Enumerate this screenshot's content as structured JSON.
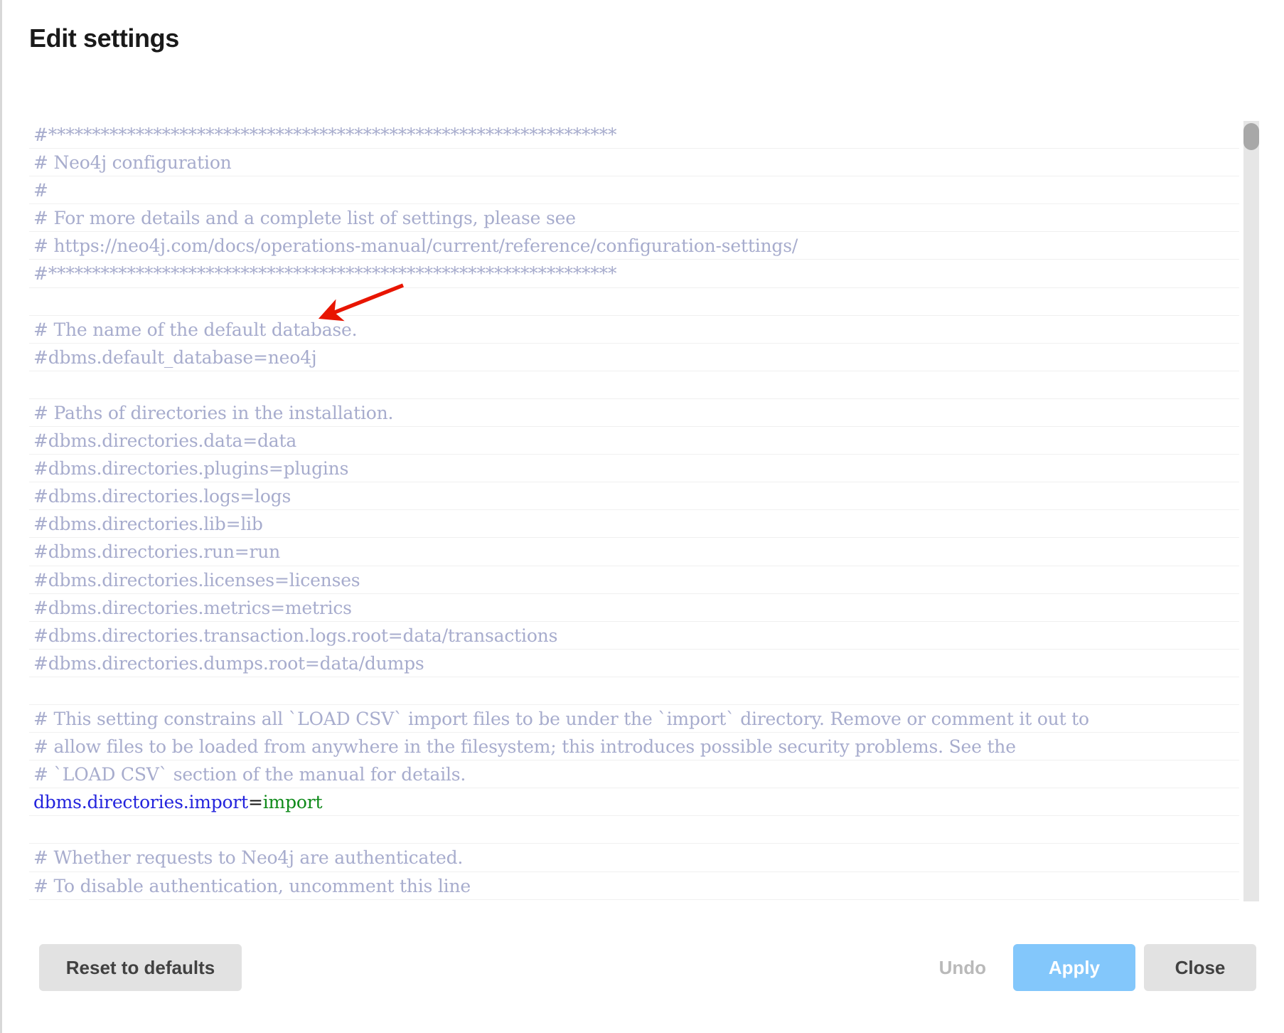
{
  "dialog": {
    "title": "Edit settings"
  },
  "editor": {
    "lines": [
      {
        "type": "comment",
        "text": "#*****************************************************************"
      },
      {
        "type": "comment",
        "text": "# Neo4j configuration"
      },
      {
        "type": "comment",
        "text": "#"
      },
      {
        "type": "comment",
        "text": "# For more details and a complete list of settings, please see"
      },
      {
        "type": "comment",
        "text": "# https://neo4j.com/docs/operations-manual/current/reference/configuration-settings/"
      },
      {
        "type": "comment",
        "text": "#*****************************************************************"
      },
      {
        "type": "blank",
        "text": ""
      },
      {
        "type": "comment",
        "text": "# The name of the default database."
      },
      {
        "type": "comment",
        "text": "#dbms.default_database=neo4j"
      },
      {
        "type": "blank",
        "text": ""
      },
      {
        "type": "comment",
        "text": "# Paths of directories in the installation."
      },
      {
        "type": "comment",
        "text": "#dbms.directories.data=data"
      },
      {
        "type": "comment",
        "text": "#dbms.directories.plugins=plugins"
      },
      {
        "type": "comment",
        "text": "#dbms.directories.logs=logs"
      },
      {
        "type": "comment",
        "text": "#dbms.directories.lib=lib"
      },
      {
        "type": "comment",
        "text": "#dbms.directories.run=run"
      },
      {
        "type": "comment",
        "text": "#dbms.directories.licenses=licenses"
      },
      {
        "type": "comment",
        "text": "#dbms.directories.metrics=metrics"
      },
      {
        "type": "comment",
        "text": "#dbms.directories.transaction.logs.root=data/transactions"
      },
      {
        "type": "comment",
        "text": "#dbms.directories.dumps.root=data/dumps"
      },
      {
        "type": "blank",
        "text": ""
      },
      {
        "type": "comment",
        "text": "# This setting constrains all `LOAD CSV` import files to be under the `import` directory. Remove or comment it out to"
      },
      {
        "type": "comment",
        "text": "# allow files to be loaded from anywhere in the filesystem; this introduces possible security problems. See the"
      },
      {
        "type": "comment",
        "text": "# `LOAD CSV` section of the manual for details."
      },
      {
        "type": "setting",
        "key": "dbms.directories.import",
        "eq": "=",
        "value": "import"
      },
      {
        "type": "blank",
        "text": ""
      },
      {
        "type": "comment",
        "text": "# Whether requests to Neo4j are authenticated."
      },
      {
        "type": "comment",
        "text": "# To disable authentication, uncomment this line"
      }
    ]
  },
  "annotation": {
    "arrow_color": "#e81500",
    "points_to": "#dbms.default_database=neo4j"
  },
  "scrollbar": {
    "thumb_position": "top"
  },
  "footer": {
    "reset_label": "Reset to defaults",
    "undo_label": "Undo",
    "apply_label": "Apply",
    "close_label": "Close"
  },
  "colors": {
    "comment": "#a7accd",
    "setting_key": "#2323dd",
    "setting_value": "#0f8a1a",
    "apply_bg": "#83c7fb",
    "button_bg": "#e2e2e2"
  }
}
